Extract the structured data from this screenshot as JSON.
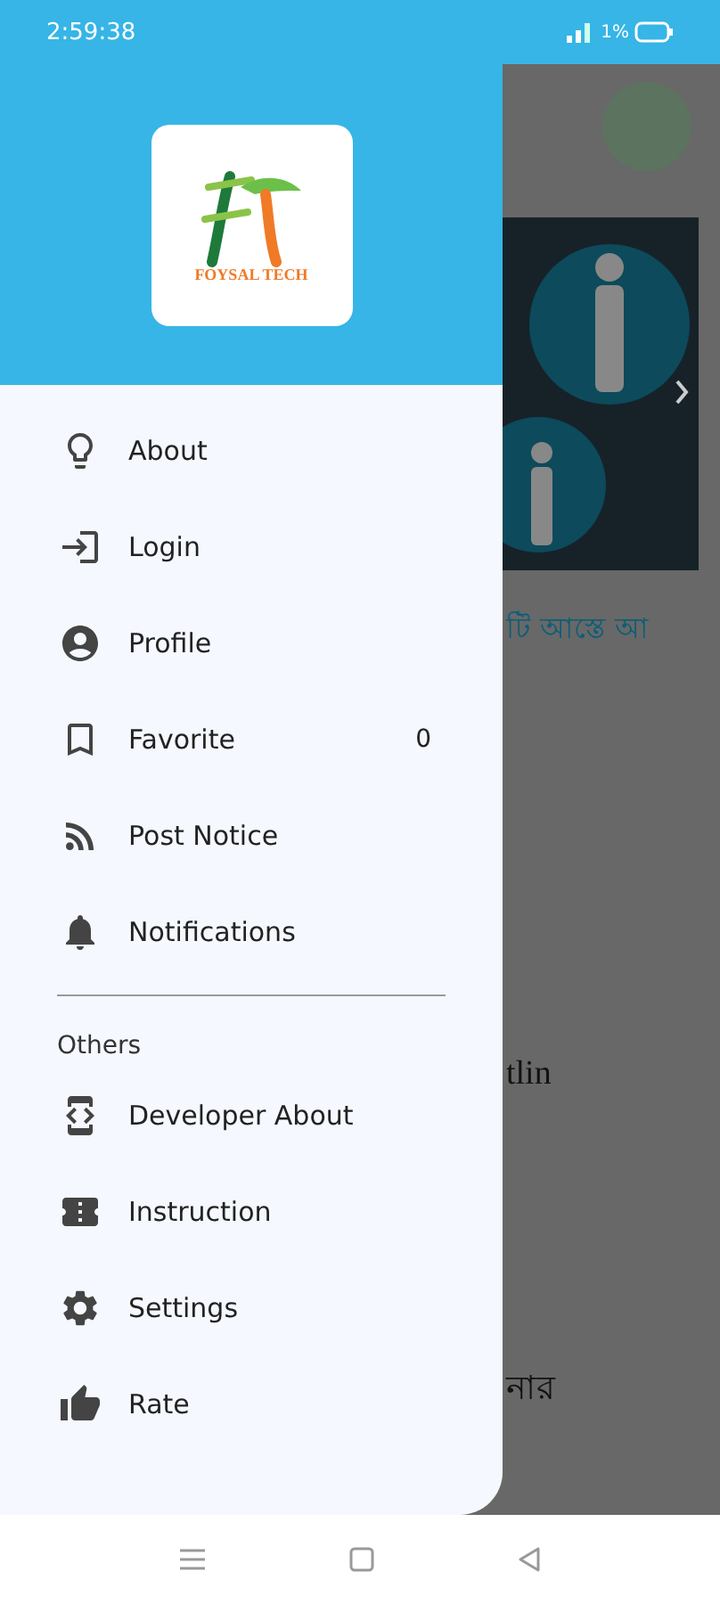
{
  "status_bar": {
    "time": "2:59:38",
    "battery": "1%"
  },
  "drawer": {
    "brand": "FOYSAL TECH",
    "items": [
      {
        "label": "About",
        "kind": "bulb"
      },
      {
        "label": "Login",
        "kind": "login"
      },
      {
        "label": "Profile",
        "kind": "account"
      },
      {
        "label": "Favorite",
        "kind": "bookmark",
        "count": "0"
      },
      {
        "label": "Post Notice",
        "kind": "rss"
      },
      {
        "label": "Notifications",
        "kind": "bell"
      }
    ],
    "section_title": "Others",
    "others": [
      {
        "label": "Developer About",
        "kind": "developer"
      },
      {
        "label": "Instruction",
        "kind": "ticket"
      },
      {
        "label": "Settings",
        "kind": "gear"
      },
      {
        "label": "Rate",
        "kind": "thumb"
      }
    ]
  },
  "behind": {
    "snippets": [
      {
        "text": "টি আস্তে আ",
        "kind": "link"
      },
      {
        "text": "tlin",
        "kind": "title"
      },
      {
        "text": "নার",
        "kind": "title"
      }
    ]
  }
}
